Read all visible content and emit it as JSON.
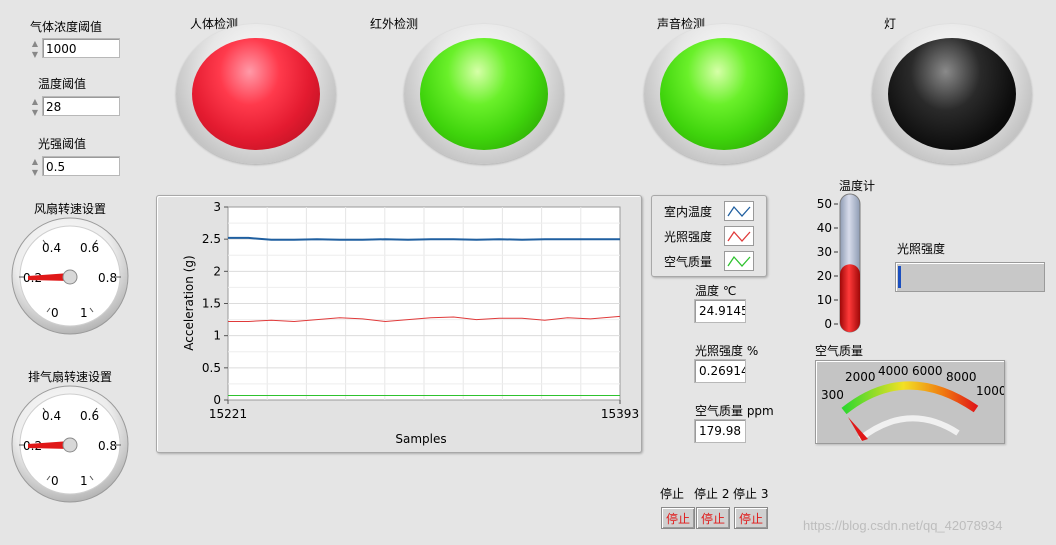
{
  "controls": {
    "gas_threshold": {
      "label": "气体浓度阈值",
      "value": "1000"
    },
    "temp_threshold": {
      "label": "温度阈值",
      "value": "28"
    },
    "light_threshold": {
      "label": "光强阈值",
      "value": "0.5"
    },
    "fan_speed": {
      "label": "风扇转速设置",
      "ticks": [
        "0.2",
        "0.4",
        "0.6",
        "0.8",
        "0",
        "1"
      ],
      "value": 0.2
    },
    "exhaust_speed": {
      "label": "排气扇转速设置",
      "ticks": [
        "0.2",
        "0.4",
        "0.6",
        "0.8",
        "0",
        "1"
      ],
      "value": 0.2
    }
  },
  "leds": [
    {
      "label": "人体检测",
      "state": "red",
      "color": "#ff3a4c"
    },
    {
      "label": "红外检测",
      "state": "green",
      "color": "#5ce81e"
    },
    {
      "label": "声音检测",
      "state": "green",
      "color": "#5ce81e"
    },
    {
      "label": "灯",
      "state": "off",
      "color": "#000000"
    }
  ],
  "chart_data": {
    "type": "line",
    "xlabel": "Samples",
    "ylabel": "Acceleration (g)",
    "xlim": [
      15221,
      15393
    ],
    "ylim": [
      0,
      3
    ],
    "yticks": [
      "0",
      "0.5",
      "1",
      "1.5",
      "2",
      "2.5",
      "3"
    ],
    "xticks": [
      "15221",
      "15393"
    ],
    "grid": true,
    "series": [
      {
        "name": "室内温度",
        "color": "#1f5fa0",
        "x": [
          15221,
          15230,
          15240,
          15250,
          15260,
          15270,
          15280,
          15290,
          15300,
          15310,
          15320,
          15330,
          15340,
          15350,
          15360,
          15370,
          15380,
          15393
        ],
        "values": [
          2.52,
          2.52,
          2.49,
          2.49,
          2.5,
          2.49,
          2.49,
          2.5,
          2.49,
          2.5,
          2.5,
          2.49,
          2.5,
          2.49,
          2.5,
          2.5,
          2.5,
          2.5
        ]
      },
      {
        "name": "光照强度",
        "color": "#e03a3a",
        "x": [
          15221,
          15230,
          15240,
          15250,
          15260,
          15270,
          15280,
          15290,
          15300,
          15310,
          15320,
          15330,
          15340,
          15350,
          15360,
          15370,
          15380,
          15393
        ],
        "values": [
          1.22,
          1.22,
          1.24,
          1.22,
          1.25,
          1.28,
          1.26,
          1.22,
          1.25,
          1.28,
          1.29,
          1.25,
          1.27,
          1.27,
          1.24,
          1.28,
          1.26,
          1.3
        ]
      },
      {
        "name": "空气质量",
        "color": "#2ec22e",
        "x": [
          15221,
          15230,
          15240,
          15250,
          15260,
          15270,
          15280,
          15290,
          15300,
          15310,
          15320,
          15330,
          15340,
          15350,
          15360,
          15370,
          15380,
          15393
        ],
        "values": [
          0.07,
          0.07,
          0.07,
          0.07,
          0.07,
          0.07,
          0.07,
          0.07,
          0.07,
          0.07,
          0.07,
          0.07,
          0.07,
          0.07,
          0.07,
          0.07,
          0.07,
          0.07
        ]
      }
    ]
  },
  "legend": [
    {
      "name": "室内温度",
      "color": "#1f5fa0"
    },
    {
      "name": "光照强度",
      "color": "#e03a3a"
    },
    {
      "name": "空气质量",
      "color": "#2ec22e"
    }
  ],
  "indicators": {
    "temperature": {
      "label": "温度 ℃",
      "value": "24.9145"
    },
    "light": {
      "label": "光照强度 %",
      "value": "0.26914"
    },
    "air": {
      "label": "空气质量 ppm",
      "value": "179.98"
    }
  },
  "thermometer": {
    "label": "温度计",
    "ticks": [
      "50",
      "40",
      "30",
      "20",
      "10",
      "0"
    ],
    "value": 24.9145,
    "max": 50,
    "color": "#e01818"
  },
  "light_bar": {
    "label": "光照强度",
    "value": 0.02
  },
  "air_meter": {
    "label": "空气质量",
    "ticks": [
      "300",
      "2000",
      "4000",
      "6000",
      "8000",
      "1000"
    ],
    "value": 179.98
  },
  "stops": {
    "labels_header": [
      "停止",
      "停止 2",
      "停止 3"
    ],
    "button_text": [
      "停止",
      "停止",
      "停止"
    ],
    "color": "#e01818"
  },
  "watermark": "https://blog.csdn.net/qq_42078934"
}
